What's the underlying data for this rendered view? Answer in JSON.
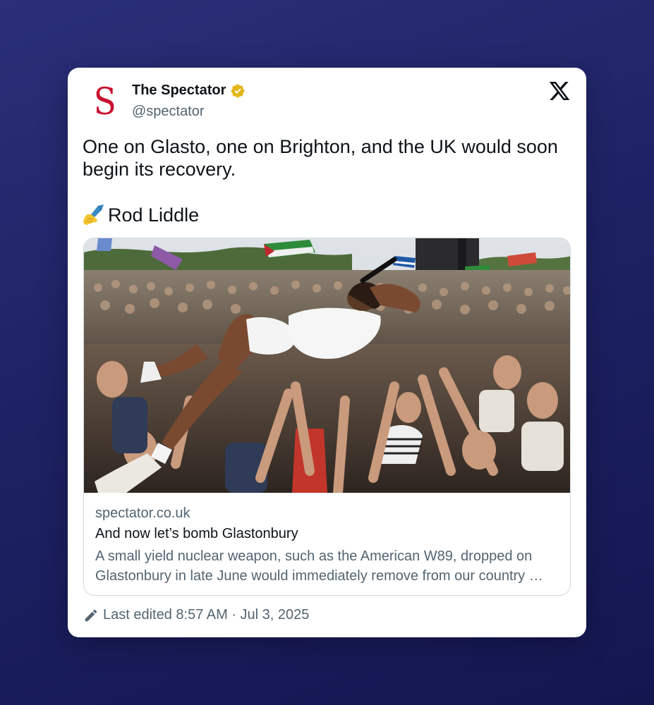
{
  "tweet": {
    "author": {
      "name": "The Spectator",
      "handle": "@spectator",
      "avatar_letter": "S",
      "avatar_color": "#c8102e",
      "verified": true,
      "verified_color": "#e2b719"
    },
    "platform_icon": "x-logo-icon",
    "text": "One on Glasto, one on Brighton, and the UK would soon begin its recovery.",
    "byline_emoji": "writing-hand-icon",
    "byline": "Rod Liddle",
    "link_card": {
      "image": "crowd-surfing-photo",
      "domain": "spectator.co.uk",
      "title": "And now let’s bomb Glastonbury",
      "description": "A small yield nuclear weapon, such as the American W89, dropped on Glastonbury in late June would immediately remove from our country …"
    },
    "edited": {
      "icon": "pencil-icon",
      "text": "Last edited 8:57 AM · Jul 3, 2025"
    }
  }
}
